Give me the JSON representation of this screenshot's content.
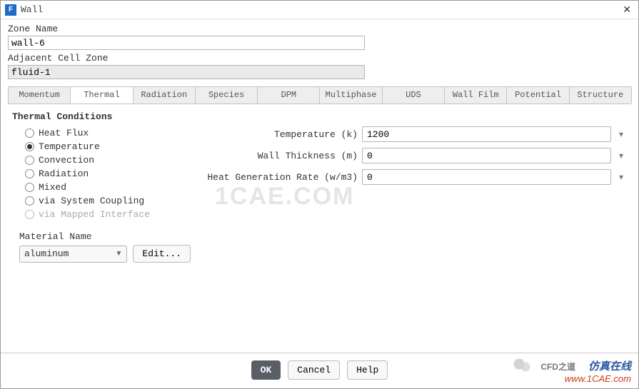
{
  "window": {
    "icon_letter": "F",
    "title": "Wall"
  },
  "zone": {
    "name_label": "Zone Name",
    "name_value": "wall-6",
    "adj_label": "Adjacent Cell Zone",
    "adj_value": "fluid-1"
  },
  "tabs": {
    "t0": "Momentum",
    "t1": "Thermal",
    "t2": "Radiation",
    "t3": "Species",
    "t4": "DPM",
    "t5": "Multiphase",
    "t6": "UDS",
    "t7": "Wall Film",
    "t8": "Potential",
    "t9": "Structure"
  },
  "thermal": {
    "section": "Thermal Conditions",
    "opts": {
      "o0": "Heat Flux",
      "o1": "Temperature",
      "o2": "Convection",
      "o3": "Radiation",
      "o4": "Mixed",
      "o5": "via System Coupling",
      "o6": "via Mapped Interface"
    },
    "selected": "o1",
    "params": {
      "temp_label": "Temperature (k)",
      "temp_value": "1200",
      "thick_label": "Wall Thickness (m)",
      "thick_value": "0",
      "hgr_label": "Heat Generation Rate (w/m3)",
      "hgr_value": "0"
    },
    "material": {
      "label": "Material Name",
      "value": "aluminum",
      "edit": "Edit..."
    }
  },
  "footer": {
    "ok": "OK",
    "cancel": "Cancel",
    "help": "Help"
  },
  "branding": {
    "watermark": "1CAE.COM",
    "cfd": "CFD之道",
    "cn": "仿真在线",
    "url": "www.1CAE.com"
  }
}
